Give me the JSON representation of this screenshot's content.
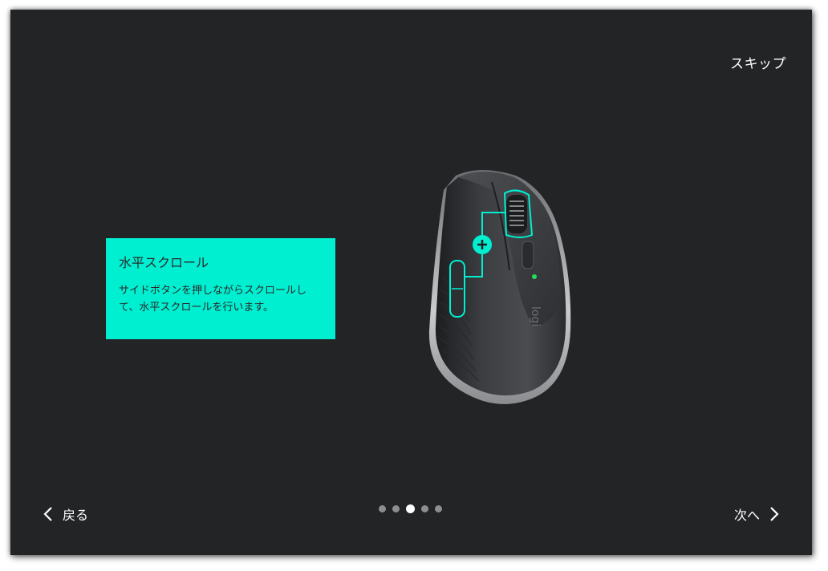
{
  "header": {
    "skip_label": "スキップ"
  },
  "card": {
    "title": "水平スクロール",
    "description": "サイドボタンを押しながらスクロールして、水平スクロールを行います。"
  },
  "illustration": {
    "name": "mouse-illustration",
    "accent_color": "#00efd1"
  },
  "footer": {
    "back_label": "戻る",
    "next_label": "次へ",
    "pagination": {
      "total": 5,
      "current": 3
    }
  },
  "colors": {
    "background": "#232426",
    "accent": "#00efd1",
    "text": "#ffffff",
    "dot_inactive": "#8d8e90",
    "dot_active": "#ffffff"
  }
}
